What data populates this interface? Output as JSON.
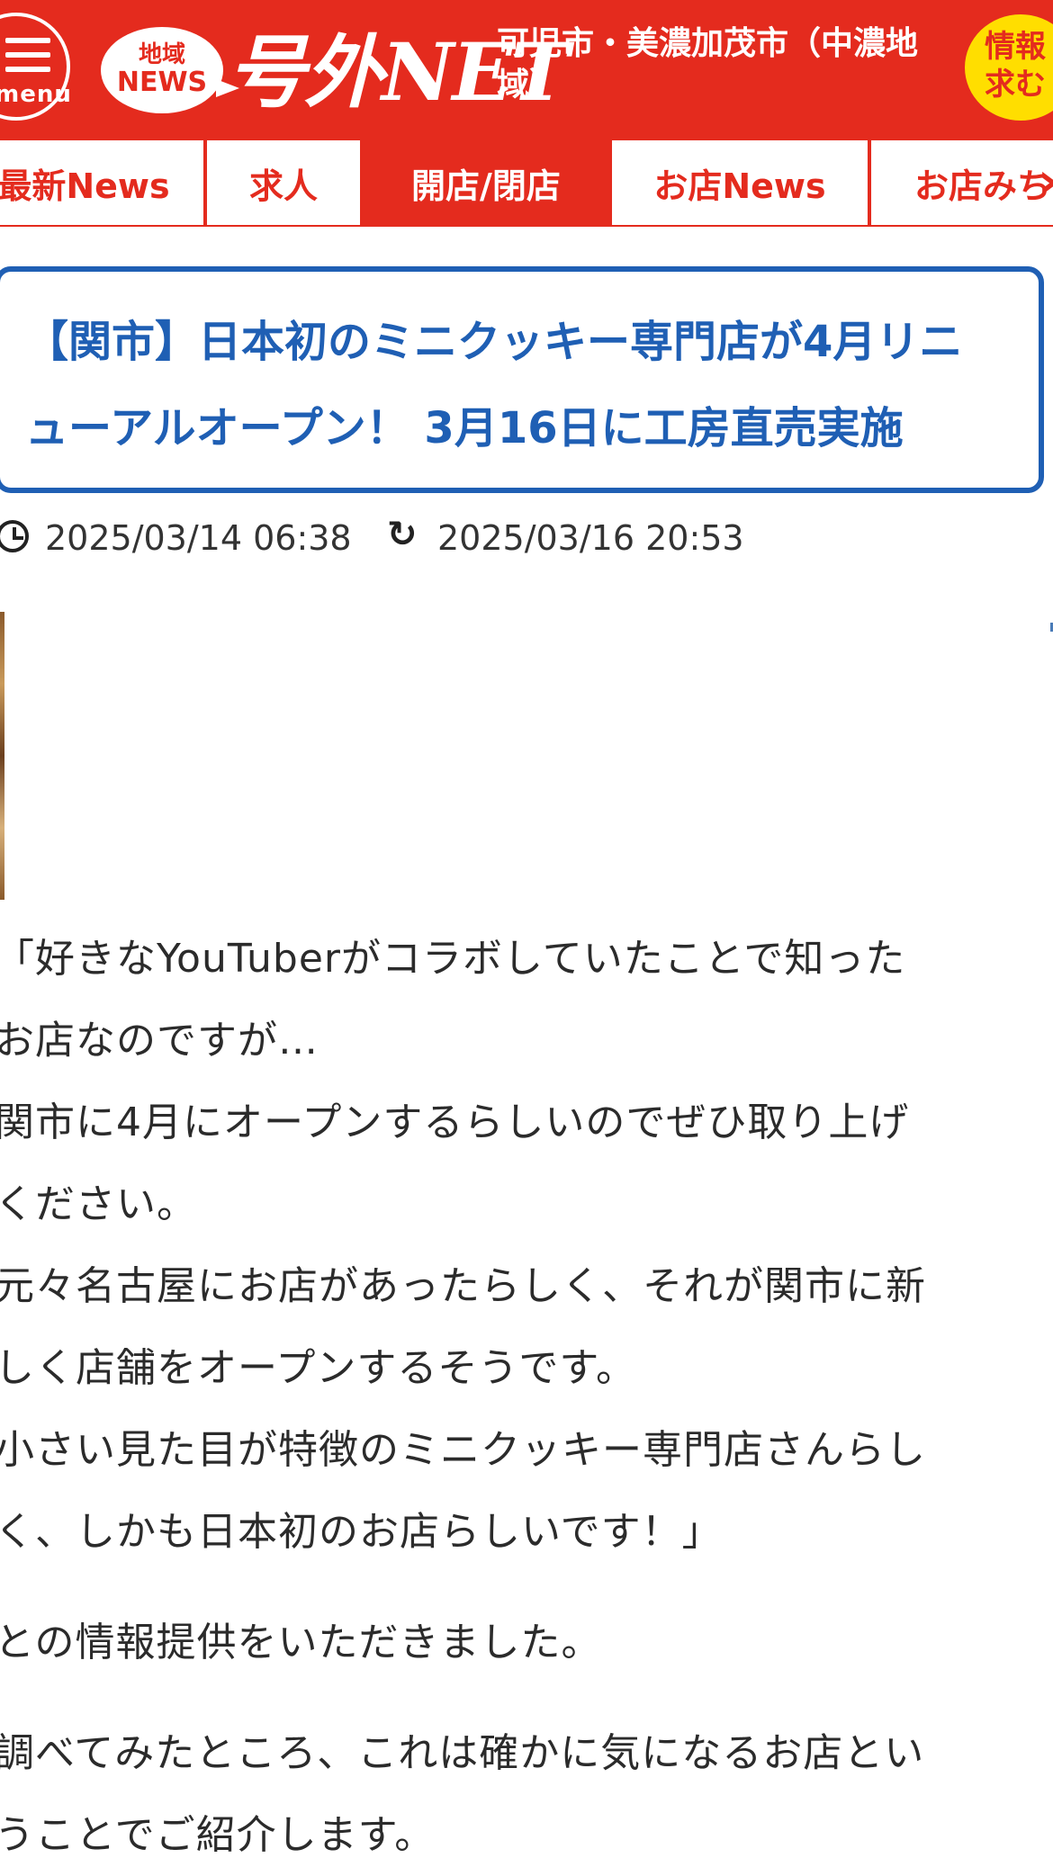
{
  "header": {
    "menu_label": "menu",
    "logo_badge_line1": "地域",
    "logo_badge_line2": "NEWS",
    "logo_word": "号外NET",
    "region": "可児市・美濃加茂市（中濃地域）",
    "info_button_line1": "情報",
    "info_button_line2": "求む",
    "colors": {
      "brand_red": "#e42b1e",
      "info_yellow": "#ffde00"
    }
  },
  "nav": {
    "tabs": [
      {
        "label": "最新News",
        "active": false
      },
      {
        "label": "求人",
        "active": false
      },
      {
        "label": "開店/閉店",
        "active": true
      },
      {
        "label": "お店News",
        "active": false
      },
      {
        "label": "お店みち",
        "active": false
      }
    ],
    "more_icon": "chevron-right-icon"
  },
  "article": {
    "title": "【関市】日本初のミニクッキー専門店が4月リニューアルオープン！ 3月16日に工房直売実施",
    "published": "2025/03/14 06:38",
    "updated": "2025/03/16 20:53",
    "title_color": "#1f5fb4",
    "paragraphs": [
      "「好きなYouTuberがコラボしていたことで知った",
      "お店なのですが…",
      "関市に4月にオープンするらしいのでぜひ取り上げ",
      "ください。",
      "元々名古屋にお店があったらしく、それが関市に新",
      "しく店舗をオープンするそうです。",
      "小さい見た目が特徴のミニクッキー専門店さんらし",
      "く、しかも日本初のお店らしいです！」",
      "との情報提供をいただきました。",
      "調べてみたところ、これは確かに気になるお店とい",
      "うことでご紹介します。"
    ]
  }
}
